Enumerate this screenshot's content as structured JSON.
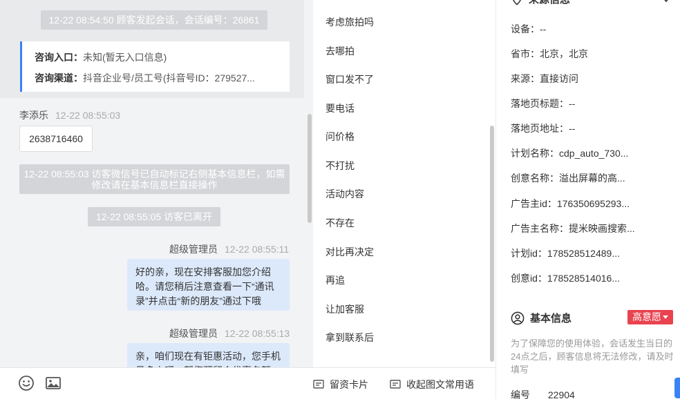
{
  "chat": {
    "session_start": "12-22 08:54:50 顾客发起会话，会话编号：26861",
    "entry_label": "咨询入口：",
    "entry_value": "未知(暂无入口信息)",
    "channel_label": "咨询渠道：",
    "channel_value": "抖音企业号/员工号(抖音号ID：279527...",
    "visitor_name": "李添乐",
    "visitor_time": "12-22 08:55:03",
    "visitor_message": "2638716460",
    "auto_tag_notice": "12-22 08:55:03 访客微信号已自动标记右侧基本信息栏，如需修改请在基本信息栏直接操作",
    "left_notice": "12-22 08:55:05 访客已离开",
    "agent1_name": "超级管理员",
    "agent1_time": "12-22 08:55:11",
    "agent1_message": "好的亲，现在安排客服加您介绍哈。请您稍后注意查看一下“通讯录”并点击“新的朋友”通过下哦",
    "agent2_name": "超级管理员",
    "agent2_time": "12-22 08:55:13",
    "agent2_message": "亲，咱们现在有钜惠活动，您手机号多少呀，帮您预留个优惠名额"
  },
  "toolbar": {
    "emoji_icon": "smile-icon",
    "image_icon": "image-icon"
  },
  "quick_replies": [
    "考虑旅拍吗",
    "去哪拍",
    "窗口发不了",
    "要电话",
    "问价格",
    "不打扰",
    "活动内容",
    "不存在",
    "对比再决定",
    "再追",
    "让加客服",
    "拿到联系后"
  ],
  "bottom_tools": {
    "lead_card": "留资卡片",
    "collapse_phrases": "收起图文常用语"
  },
  "info_panel": {
    "source_title": "来源信息",
    "fields": [
      "设备：--",
      "省市：北京，北京",
      "来源：直接访问",
      "落地页标题：--",
      "落地页地址：--",
      "计划名称：cdp_auto_730...",
      "创意名称：溢出屏幕的高...",
      "广告主id：176350695293...",
      "广告主名称：提米映画搜索...",
      "计划id：178528512489...",
      "创意id：178528514016..."
    ],
    "basic_title": "基本信息",
    "intent_badge": "高意愿",
    "notice": "为了保障您的使用体验，会话发生当日的24点之后，顾客信息将无法修改，请及时填写",
    "number_label": "编号",
    "number_value": "22904"
  },
  "colors": {
    "accent": "#3b82f6",
    "badge": "#e8434f",
    "agent_bubble": "#dce9fb"
  }
}
